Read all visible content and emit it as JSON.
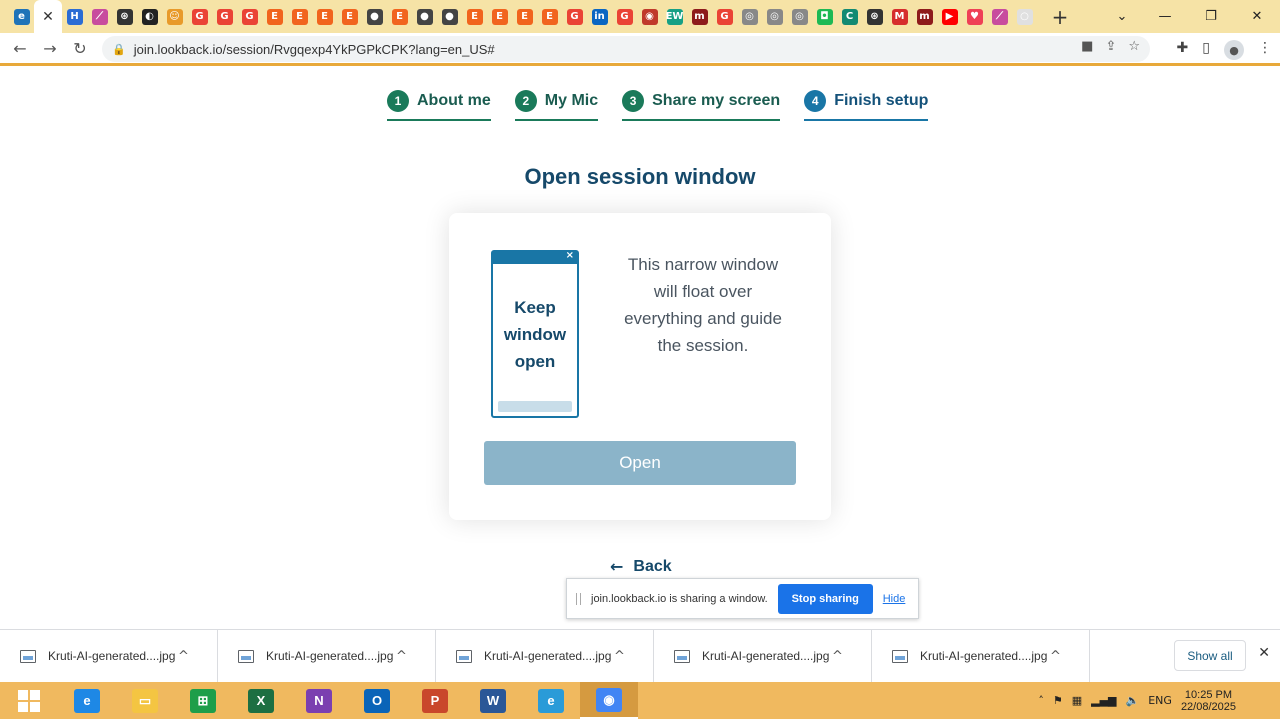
{
  "browser": {
    "tabs_favicons": [
      {
        "name": "edge-favicon-icon",
        "color": "#1f73b8",
        "glyph": "e"
      },
      {
        "name": "hashnode-favicon-icon",
        "color": "#2b6cd4",
        "glyph": "H"
      },
      {
        "name": "colorful-feather-favicon-icon",
        "color": "#c84b9e",
        "glyph": "⟋"
      },
      {
        "name": "openai-favicon-icon",
        "color": "#333333",
        "glyph": "⊛"
      },
      {
        "name": "swirl-favicon-icon",
        "color": "#222222",
        "glyph": "◐"
      },
      {
        "name": "face-favicon-icon",
        "color": "#e89a2a",
        "glyph": "☺"
      },
      {
        "name": "google-favicon-icon",
        "color": "#ea4335",
        "glyph": "G"
      },
      {
        "name": "google-favicon-icon",
        "color": "#ea4335",
        "glyph": "G"
      },
      {
        "name": "google-favicon-icon",
        "color": "#ea4335",
        "glyph": "G"
      },
      {
        "name": "etsy-favicon-icon",
        "color": "#f1641e",
        "glyph": "E"
      },
      {
        "name": "etsy-favicon-icon",
        "color": "#f1641e",
        "glyph": "E"
      },
      {
        "name": "etsy-favicon-icon",
        "color": "#f1641e",
        "glyph": "E"
      },
      {
        "name": "etsy-favicon-icon",
        "color": "#f1641e",
        "glyph": "E"
      },
      {
        "name": "circle-favicon-icon",
        "color": "#444444",
        "glyph": "●"
      },
      {
        "name": "etsy-favicon-icon",
        "color": "#f1641e",
        "glyph": "E"
      },
      {
        "name": "circle-favicon-icon",
        "color": "#444444",
        "glyph": "●"
      },
      {
        "name": "circle-favicon-icon",
        "color": "#444444",
        "glyph": "●"
      },
      {
        "name": "etsy-favicon-icon",
        "color": "#f1641e",
        "glyph": "E"
      },
      {
        "name": "etsy-favicon-icon",
        "color": "#f1641e",
        "glyph": "E"
      },
      {
        "name": "etsy-favicon-icon",
        "color": "#f1641e",
        "glyph": "E"
      },
      {
        "name": "etsy-favicon-icon",
        "color": "#f1641e",
        "glyph": "E"
      },
      {
        "name": "google-favicon-icon",
        "color": "#ea4335",
        "glyph": "G"
      },
      {
        "name": "linkedin-favicon-icon",
        "color": "#0a66c2",
        "glyph": "in"
      },
      {
        "name": "google-favicon-icon",
        "color": "#ea4335",
        "glyph": "G"
      },
      {
        "name": "flag-favicon-icon",
        "color": "#c0392b",
        "glyph": "◉"
      },
      {
        "name": "ew-favicon-icon",
        "color": "#16a085",
        "glyph": "EW"
      },
      {
        "name": "m-favicon-icon",
        "color": "#8e1b1b",
        "glyph": "m"
      },
      {
        "name": "google-favicon-icon",
        "color": "#ea4335",
        "glyph": "G"
      },
      {
        "name": "eye-favicon-icon",
        "color": "#888888",
        "glyph": "◎"
      },
      {
        "name": "eye-favicon-icon",
        "color": "#888888",
        "glyph": "◎"
      },
      {
        "name": "eye-favicon-icon",
        "color": "#888888",
        "glyph": "◎"
      },
      {
        "name": "green-square-favicon-icon",
        "color": "#1db954",
        "glyph": "◘"
      },
      {
        "name": "teal-favicon-icon",
        "color": "#138a72",
        "glyph": "C"
      },
      {
        "name": "openai-favicon-icon",
        "color": "#333333",
        "glyph": "⊛"
      },
      {
        "name": "m-red-favicon-icon",
        "color": "#d62d2d",
        "glyph": "M"
      },
      {
        "name": "m-favicon-icon",
        "color": "#8e1b1b",
        "glyph": "m"
      },
      {
        "name": "youtube-favicon-icon",
        "color": "#ff0000",
        "glyph": "▶"
      },
      {
        "name": "pocket-favicon-icon",
        "color": "#ef4056",
        "glyph": "♥"
      },
      {
        "name": "colorful-feather-favicon-icon",
        "color": "#c84b9e",
        "glyph": "⟋"
      },
      {
        "name": "blank-favicon-icon",
        "color": "#e0e0e0",
        "glyph": "○"
      }
    ],
    "new_tab_label": "+",
    "url": "join.lookback.io/session/Rvgqexp4YkPGPkCPK?lang=en_US#"
  },
  "steps": [
    {
      "num": "1",
      "label": "About me"
    },
    {
      "num": "2",
      "label": "My Mic"
    },
    {
      "num": "3",
      "label": "Share my screen"
    },
    {
      "num": "4",
      "label": "Finish setup"
    }
  ],
  "heading": "Open session window",
  "card": {
    "mini_window_line1": "Keep",
    "mini_window_line2": "window",
    "mini_window_line3": "open",
    "description_line1": "This narrow window",
    "description_line2": "will float over",
    "description_line3": "everything and guide",
    "description_line4": "the session.",
    "open_button": "Open"
  },
  "back_label": "Back",
  "share_bar": {
    "message": "join.lookback.io is sharing a window.",
    "stop_button": "Stop sharing",
    "hide_link": "Hide"
  },
  "downloads": [
    {
      "name": "Kruti-AI-generated....jpg"
    },
    {
      "name": "Kruti-AI-generated....jpg"
    },
    {
      "name": "Kruti-AI-generated....jpg"
    },
    {
      "name": "Kruti-AI-generated....jpg"
    },
    {
      "name": "Kruti-AI-generated....jpg"
    }
  ],
  "show_all": "Show all",
  "taskbar": {
    "apps": [
      {
        "name": "internet-explorer-icon",
        "color": "#1e88e5",
        "glyph": "e"
      },
      {
        "name": "file-explorer-icon",
        "color": "#f4c542",
        "glyph": "▭"
      },
      {
        "name": "store-icon",
        "color": "#1e9e4a",
        "glyph": "⊞"
      },
      {
        "name": "excel-icon",
        "color": "#1d6f42",
        "glyph": "X"
      },
      {
        "name": "onenote-icon",
        "color": "#7b3fb0",
        "glyph": "N"
      },
      {
        "name": "outlook-icon",
        "color": "#0a64b8",
        "glyph": "O"
      },
      {
        "name": "powerpoint-icon",
        "color": "#c9472b",
        "glyph": "P"
      },
      {
        "name": "word-icon",
        "color": "#2b5797",
        "glyph": "W"
      },
      {
        "name": "edge-icon",
        "color": "#2a9bd8",
        "glyph": "e"
      },
      {
        "name": "chrome-icon",
        "color": "#4285f4",
        "glyph": "◉"
      }
    ],
    "language": "ENG",
    "time": "10:25 PM",
    "date": "22/08/2025"
  }
}
